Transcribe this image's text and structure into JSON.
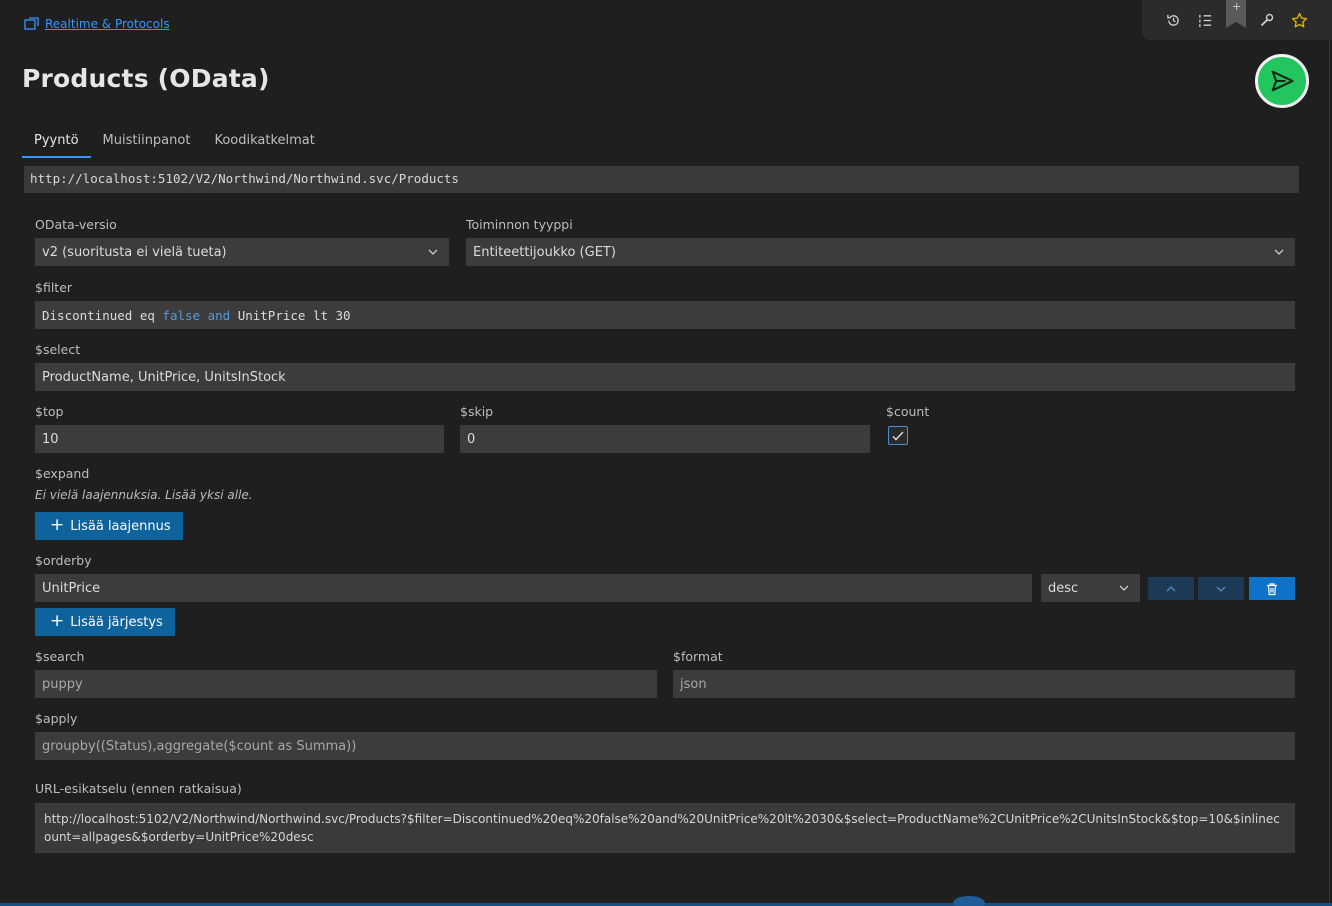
{
  "breadcrumb": {
    "label": "Realtime & Protocols"
  },
  "title": "Products (OData)",
  "tabs": [
    {
      "label": "Pyyntö",
      "active": true
    },
    {
      "label": "Muistiinpanot",
      "active": false
    },
    {
      "label": "Koodikatkelmat",
      "active": false
    }
  ],
  "toolbar": {
    "icons": [
      "history-icon",
      "list-icon",
      "bookmark-icon",
      "wrench-icon",
      "star-icon"
    ],
    "bookmark_plus": "+"
  },
  "request": {
    "url": "http://localhost:5102/V2/Northwind/Northwind.svc/Products"
  },
  "odata_version": {
    "label": "OData-versio",
    "value": "v2 (suoritusta ei vielä tueta)"
  },
  "operation_type": {
    "label": "Toiminnon tyyppi",
    "value": "Entiteettijoukko (GET)"
  },
  "filter": {
    "label": "$filter",
    "tokens": [
      "Discontinued eq ",
      "false",
      " ",
      "and",
      " UnitPrice lt 30"
    ]
  },
  "select": {
    "label": "$select",
    "value": "ProductName, UnitPrice, UnitsInStock"
  },
  "top": {
    "label": "$top",
    "value": "10"
  },
  "skip": {
    "label": "$skip",
    "value": "0"
  },
  "count": {
    "label": "$count",
    "checked": true
  },
  "expand": {
    "label": "$expand",
    "empty_hint": "Ei vielä laajennuksia. Lisää yksi alle.",
    "add_label": "Lisää laajennus"
  },
  "orderby": {
    "label": "$orderby",
    "field": "UnitPrice",
    "direction": "desc",
    "add_label": "Lisää järjestys"
  },
  "search": {
    "label": "$search",
    "placeholder": "puppy"
  },
  "format": {
    "label": "$format",
    "placeholder": "json"
  },
  "apply": {
    "label": "$apply",
    "placeholder": "groupby((Status),aggregate($count as Summa))"
  },
  "preview": {
    "label": "URL-esikatselu (ennen ratkaisua)",
    "value": "http://localhost:5102/V2/Northwind/Northwind.svc/Products?$filter=Discontinued%20eq%20false%20and%20UnitPrice%20lt%2030&$select=ProductName%2CUnitPrice%2CUnitsInStock&$top=10&$inlinecount=allpages&$orderby=UnitPrice%20desc"
  },
  "colors": {
    "accent": "#0e639c",
    "send": "#23c55e",
    "link": "#3794ff",
    "keyword": "#569cd6"
  }
}
